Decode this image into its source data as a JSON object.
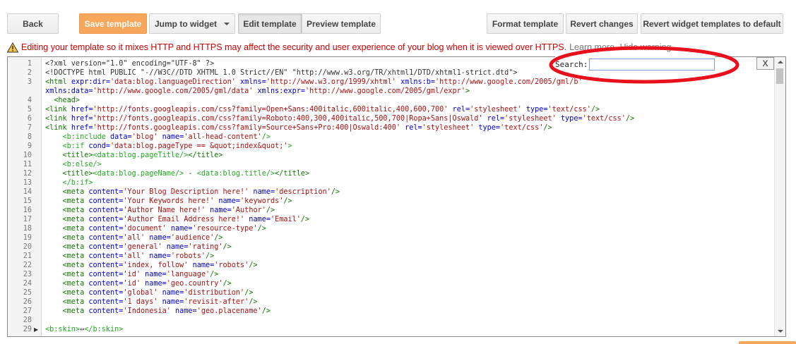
{
  "toolbar": {
    "back": "Back",
    "save_template": "Save template",
    "jump_to_widget": "Jump to widget",
    "edit_template": "Edit template",
    "preview_template": "Preview template",
    "format_template": "Format template",
    "revert_changes": "Revert changes",
    "revert_widgets": "Revert widget templates to default"
  },
  "warning": {
    "text": "Editing your template so it mixes HTTP and HTTPS may affect the security and user experience of your blog when it is viewed over HTTPS.",
    "learn_more": "Learn more.",
    "hide_warning": "Hide warning"
  },
  "search": {
    "label": "Search:",
    "value": "",
    "close_label": "X"
  },
  "colors": {
    "accent_orange": "#f7a75b",
    "warning_red": "#cc0000",
    "annotation_red": "#e8101c",
    "tag_green": "#117700",
    "attr_blue": "#0000cc",
    "string_red": "#aa1111"
  },
  "editor": {
    "lines": [
      {
        "num": "1",
        "segs": [
          [
            "p",
            "<?xml version=\"1.0\" encoding=\"UTF-8\" ?>"
          ]
        ]
      },
      {
        "num": "2",
        "segs": [
          [
            "p",
            "<!DOCTYPE html PUBLIC \"-//W3C//DTD XHTML 1.0 Strict//EN\" \"http://www.w3.org/TR/xhtml1/DTD/xhtml1-strict.dtd\">"
          ]
        ]
      },
      {
        "num": "3",
        "segs": [
          [
            "t",
            "<html "
          ],
          [
            "a",
            "expr:dir="
          ],
          [
            "s",
            "'data:blog.languageDirection'"
          ],
          [
            "a",
            " xmlns="
          ],
          [
            "s",
            "'http://www.w3.org/1999/xhtml'"
          ],
          [
            "a",
            " xmlns:b="
          ],
          [
            "s",
            "'http://www.google.com/2005/gml/b'"
          ]
        ]
      },
      {
        "num": "",
        "segs": [
          [
            "a",
            "xmlns:data="
          ],
          [
            "s",
            "'http://www.google.com/2005/gml/data'"
          ],
          [
            "a",
            " xmlns:expr="
          ],
          [
            "s",
            "'http://www.google.com/2005/gml/expr'"
          ],
          [
            "t",
            ">"
          ]
        ]
      },
      {
        "num": "4",
        "segs": [
          [
            "t",
            "  <head>"
          ]
        ]
      },
      {
        "num": "5",
        "segs": [
          [
            "t",
            "<link "
          ],
          [
            "a",
            "href="
          ],
          [
            "s",
            "'http://fonts.googleapis.com/css?family=Open+Sans:400italic,600italic,400,600,700'"
          ],
          [
            "a",
            " rel="
          ],
          [
            "s",
            "'stylesheet'"
          ],
          [
            "a",
            " type="
          ],
          [
            "s",
            "'text/css'"
          ],
          [
            "t",
            "/>"
          ]
        ]
      },
      {
        "num": "6",
        "segs": [
          [
            "t",
            "<link "
          ],
          [
            "a",
            "href="
          ],
          [
            "s",
            "'http://fonts.googleapis.com/css?family=Roboto:400,300,400italic,500,700|Ropa+Sans|Oswald'"
          ],
          [
            "a",
            " rel="
          ],
          [
            "s",
            "'stylesheet'"
          ],
          [
            "a",
            " type="
          ],
          [
            "s",
            "'text/css'"
          ],
          [
            "t",
            "/>"
          ]
        ]
      },
      {
        "num": "7",
        "segs": [
          [
            "t",
            "<link "
          ],
          [
            "a",
            "href="
          ],
          [
            "s",
            "'http://fonts.googleapis.com/css?family=Source+Sans+Pro:400|Oswald:400'"
          ],
          [
            "a",
            " rel="
          ],
          [
            "s",
            "'stylesheet'"
          ],
          [
            "a",
            " type="
          ],
          [
            "s",
            "'text/css'"
          ],
          [
            "t",
            "/>"
          ]
        ]
      },
      {
        "num": "8",
        "segs": [
          [
            "tg",
            "    <b:include "
          ],
          [
            "a",
            "data="
          ],
          [
            "s",
            "'blog'"
          ],
          [
            "a",
            " name="
          ],
          [
            "s",
            "'all-head-content'"
          ],
          [
            "tg",
            "/>"
          ]
        ]
      },
      {
        "num": "9",
        "segs": [
          [
            "tg",
            "    <b:if "
          ],
          [
            "a",
            "cond="
          ],
          [
            "s",
            "'data:blog.pageType == &quot;index&quot;'"
          ],
          [
            "tg",
            ">"
          ]
        ]
      },
      {
        "num": "10",
        "segs": [
          [
            "t",
            "    <title>"
          ],
          [
            "tg",
            "<data:blog.pageTitle/>"
          ],
          [
            "t",
            "</title>"
          ]
        ]
      },
      {
        "num": "11",
        "segs": [
          [
            "tg",
            "    <b:else/>"
          ]
        ]
      },
      {
        "num": "12",
        "segs": [
          [
            "t",
            "    <title>"
          ],
          [
            "tg",
            "<data:blog.pageName/>"
          ],
          [
            "p",
            " - "
          ],
          [
            "tg",
            "<data:blog.title/>"
          ],
          [
            "t",
            "</title>"
          ]
        ]
      },
      {
        "num": "13",
        "segs": [
          [
            "tg",
            "    </b:if>"
          ]
        ]
      },
      {
        "num": "14",
        "segs": [
          [
            "t",
            "    <meta "
          ],
          [
            "a",
            "content="
          ],
          [
            "s",
            "'Your Blog Description here!'"
          ],
          [
            "a",
            " name="
          ],
          [
            "s",
            "'description'"
          ],
          [
            "t",
            "/>"
          ]
        ]
      },
      {
        "num": "15",
        "segs": [
          [
            "t",
            "    <meta "
          ],
          [
            "a",
            "content="
          ],
          [
            "s",
            "'Your Keywords here!'"
          ],
          [
            "a",
            " name="
          ],
          [
            "s",
            "'keywords'"
          ],
          [
            "t",
            "/>"
          ]
        ]
      },
      {
        "num": "16",
        "segs": [
          [
            "t",
            "    <meta "
          ],
          [
            "a",
            "content="
          ],
          [
            "s",
            "'Author Name here!'"
          ],
          [
            "a",
            " name="
          ],
          [
            "s",
            "'Author'"
          ],
          [
            "t",
            "/>"
          ]
        ]
      },
      {
        "num": "17",
        "segs": [
          [
            "t",
            "    <meta "
          ],
          [
            "a",
            "content="
          ],
          [
            "s",
            "'Author Email Address here!'"
          ],
          [
            "a",
            " name="
          ],
          [
            "s",
            "'Email'"
          ],
          [
            "t",
            "/>"
          ]
        ]
      },
      {
        "num": "18",
        "segs": [
          [
            "t",
            "    <meta "
          ],
          [
            "a",
            "content="
          ],
          [
            "s",
            "'document'"
          ],
          [
            "a",
            " name="
          ],
          [
            "s",
            "'resource-type'"
          ],
          [
            "t",
            "/>"
          ]
        ]
      },
      {
        "num": "19",
        "segs": [
          [
            "t",
            "    <meta "
          ],
          [
            "a",
            "content="
          ],
          [
            "s",
            "'all'"
          ],
          [
            "a",
            " name="
          ],
          [
            "s",
            "'audience'"
          ],
          [
            "t",
            "/>"
          ]
        ]
      },
      {
        "num": "20",
        "segs": [
          [
            "t",
            "    <meta "
          ],
          [
            "a",
            "content="
          ],
          [
            "s",
            "'general'"
          ],
          [
            "a",
            " name="
          ],
          [
            "s",
            "'rating'"
          ],
          [
            "t",
            "/>"
          ]
        ]
      },
      {
        "num": "21",
        "segs": [
          [
            "t",
            "    <meta "
          ],
          [
            "a",
            "content="
          ],
          [
            "s",
            "'all'"
          ],
          [
            "a",
            " name="
          ],
          [
            "s",
            "'robots'"
          ],
          [
            "t",
            "/>"
          ]
        ]
      },
      {
        "num": "22",
        "segs": [
          [
            "t",
            "    <meta "
          ],
          [
            "a",
            "content="
          ],
          [
            "s",
            "'index, follow'"
          ],
          [
            "a",
            " name="
          ],
          [
            "s",
            "'robots'"
          ],
          [
            "t",
            "/>"
          ]
        ]
      },
      {
        "num": "23",
        "segs": [
          [
            "t",
            "    <meta "
          ],
          [
            "a",
            "content="
          ],
          [
            "s",
            "'id'"
          ],
          [
            "a",
            " name="
          ],
          [
            "s",
            "'language'"
          ],
          [
            "t",
            "/>"
          ]
        ]
      },
      {
        "num": "24",
        "segs": [
          [
            "t",
            "    <meta "
          ],
          [
            "a",
            "content="
          ],
          [
            "s",
            "'id'"
          ],
          [
            "a",
            " name="
          ],
          [
            "s",
            "'geo.country'"
          ],
          [
            "t",
            "/>"
          ]
        ]
      },
      {
        "num": "25",
        "segs": [
          [
            "t",
            "    <meta "
          ],
          [
            "a",
            "content="
          ],
          [
            "s",
            "'global'"
          ],
          [
            "a",
            " name="
          ],
          [
            "s",
            "'distribution'"
          ],
          [
            "t",
            "/>"
          ]
        ]
      },
      {
        "num": "26",
        "segs": [
          [
            "t",
            "    <meta "
          ],
          [
            "a",
            "content="
          ],
          [
            "s",
            "'1 days'"
          ],
          [
            "a",
            " name="
          ],
          [
            "s",
            "'revisit-after'"
          ],
          [
            "t",
            "/>"
          ]
        ]
      },
      {
        "num": "27",
        "segs": [
          [
            "t",
            "    <meta "
          ],
          [
            "a",
            "content="
          ],
          [
            "s",
            "'Indonesia'"
          ],
          [
            "a",
            " name="
          ],
          [
            "s",
            "'geo.placename'"
          ],
          [
            "t",
            "/>"
          ]
        ]
      },
      {
        "num": "28",
        "segs": []
      },
      {
        "num": "29",
        "fold": "▶",
        "segs": [
          [
            "tg",
            "<b:skin>"
          ],
          [
            "p",
            "↔"
          ],
          [
            "tg",
            "</b:skin>"
          ]
        ]
      }
    ]
  }
}
